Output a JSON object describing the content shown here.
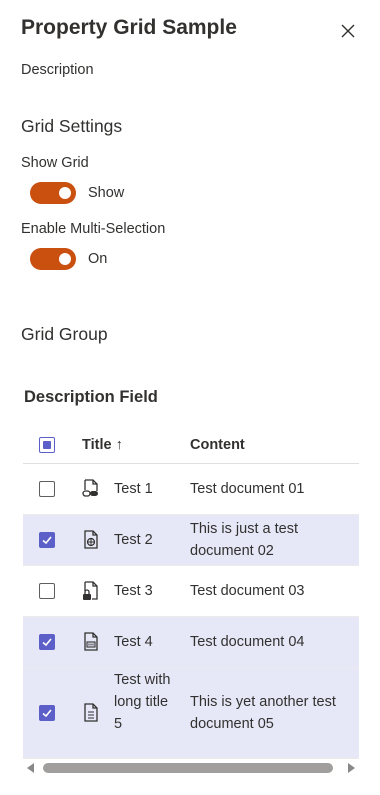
{
  "panel": {
    "title": "Property Grid Sample",
    "description": "Description"
  },
  "grid_settings": {
    "heading": "Grid Settings",
    "show_grid": {
      "label": "Show Grid",
      "on": true,
      "state_text": "Show"
    },
    "multi_selection": {
      "label": "Enable Multi-Selection",
      "on": true,
      "state_text": "On"
    }
  },
  "grid_group": {
    "heading": "Grid Group"
  },
  "grid": {
    "caption": "Description Field",
    "columns": {
      "title": "Title",
      "title_sort_icon": "↑",
      "content": "Content"
    },
    "header_checkbox": "partial",
    "rows": [
      {
        "title": "Test 1",
        "content": "Test document 01",
        "selected": false,
        "icon": "file-link-icon"
      },
      {
        "title": "Test 2",
        "content": "This is just a test document 02",
        "selected": true,
        "icon": "file-globe-icon"
      },
      {
        "title": "Test 3",
        "content": "Test document 03",
        "selected": false,
        "icon": "file-lock-icon"
      },
      {
        "title": "Test 4",
        "content": "Test document 04",
        "selected": true,
        "icon": "file-binary-icon"
      },
      {
        "title": "Test with long title 5",
        "content": "This is yet another test document 05",
        "selected": true,
        "icon": "document-icon"
      }
    ]
  },
  "colors": {
    "toggle_on": "#ca5010",
    "checkbox_accent": "#5b5fc7",
    "selected_row": "#e6e8f7"
  }
}
